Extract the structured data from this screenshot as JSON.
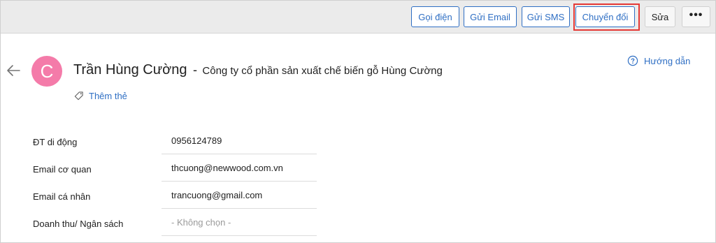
{
  "toolbar": {
    "call_label": "Gọi điện",
    "email_label": "Gửi Email",
    "sms_label": "Gửi SMS",
    "convert_label": "Chuyển đổi",
    "edit_label": "Sửa",
    "more_label": "•••"
  },
  "header": {
    "avatar_letter": "C",
    "contact_name": "Trần Hùng Cường",
    "separator": "-",
    "company": "Công ty cổ phần sản xuất chế biến gỗ Hùng Cường",
    "help_label": "Hướng dẫn",
    "add_tag_label": "Thêm thẻ"
  },
  "fields": [
    {
      "label": "ĐT di động",
      "value": "0956124789"
    },
    {
      "label": "Email cơ quan",
      "value": "thcuong@newwood.com.vn"
    },
    {
      "label": "Email cá nhân",
      "value": "trancuong@gmail.com"
    },
    {
      "label": "Doanh thu/ Ngân sách",
      "value": "- Không chọn -"
    }
  ],
  "colors": {
    "accent": "#2f6fc4",
    "avatar": "#f47ba9",
    "highlight": "#e53935",
    "toolbar_bg": "#ebebeb"
  },
  "icons": {
    "back": "arrow-left-icon",
    "help": "question-circle-icon",
    "tag": "tag-icon",
    "more": "more-horizontal-icon"
  }
}
